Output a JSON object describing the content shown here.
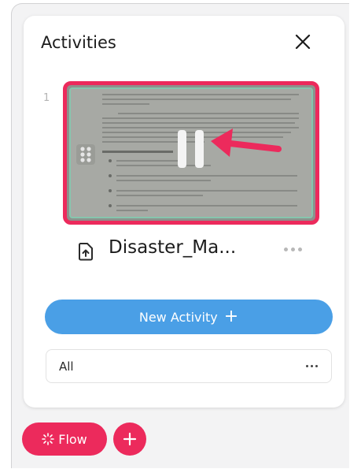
{
  "panel": {
    "title": "Activities",
    "close_icon": "close-icon"
  },
  "activity": {
    "index": "1",
    "file_name": "Disaster_Ma...",
    "file_icon": "file-upload-icon",
    "thumbnail_icons": [
      "drag-handle-icon",
      "pause-icon",
      "arrow-annotation-icon"
    ],
    "highlight_color": "#ec2a5c"
  },
  "actions": {
    "new_activity_label": "New Activity",
    "new_activity_plus": "+",
    "filter_label": "All"
  },
  "footer": {
    "flow_label": "Flow",
    "flow_icon": "sparkle-icon",
    "add_icon": "plus-icon"
  },
  "colors": {
    "accent_pink": "#ec2a5c",
    "primary_blue": "#4a9fe6"
  }
}
